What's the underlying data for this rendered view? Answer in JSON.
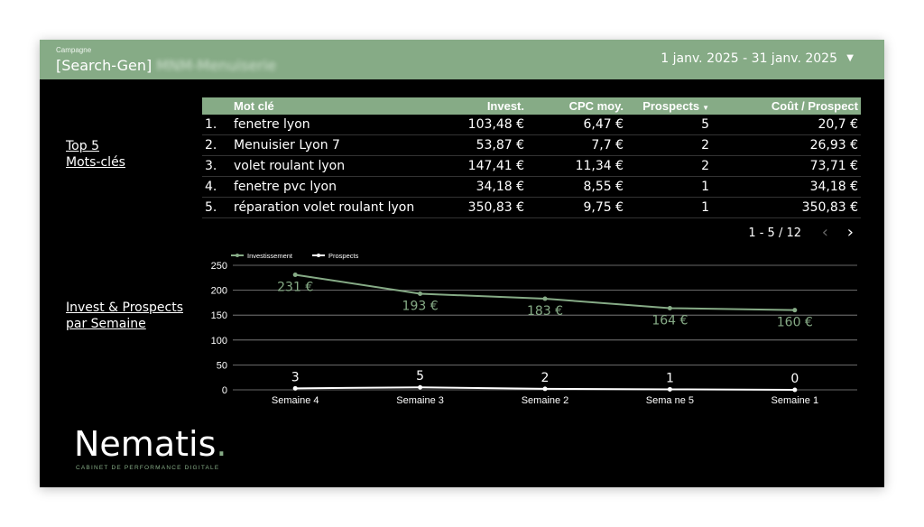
{
  "header": {
    "campaign_label": "Campagne",
    "campaign_name": "[Search-Gen]",
    "campaign_name_blurred": "MNM-Menuiserie",
    "date_range": "1 janv. 2025 - 31 janv. 2025",
    "date_caret": "▼"
  },
  "side": {
    "top_line1": "Top 5",
    "top_line2": "Mots-clés",
    "invest_line1": "Invest & Prospects",
    "invest_line2": "par Semaine"
  },
  "table": {
    "headers": [
      "Mot clé",
      "Invest.",
      "CPC moy.",
      "Prospects",
      "Coût / Prospect"
    ],
    "sort_caret": "▼",
    "rows": [
      [
        "1.",
        "fenetre lyon",
        "103,48 €",
        "6,47 €",
        "5",
        "20,7 €"
      ],
      [
        "2.",
        "Menuisier Lyon 7",
        "53,87 €",
        "7,7 €",
        "2",
        "26,93 €"
      ],
      [
        "3.",
        "volet roulant lyon",
        "147,41 €",
        "11,34 €",
        "2",
        "73,71 €"
      ],
      [
        "4.",
        "fenetre pvc lyon",
        "34,18 €",
        "8,55 €",
        "1",
        "34,18 €"
      ],
      [
        "5.",
        "réparation volet roulant lyon",
        "350,83 €",
        "9,75 €",
        "1",
        "350,83 €"
      ]
    ]
  },
  "pager": {
    "text": "1 - 5 / 12",
    "prev": "‹",
    "next": "›"
  },
  "chart_data": {
    "type": "line",
    "categories": [
      "Semaine 4",
      "Semaine 3",
      "Semaine 2",
      "Sema ne 5",
      "Semaine 1"
    ],
    "series": [
      {
        "name": "Investissement",
        "values": [
          231,
          193,
          183,
          164,
          160
        ],
        "labels": [
          "231 €",
          "193 €",
          "183 €",
          "164 €",
          "160 €"
        ],
        "color": "#86ab86"
      },
      {
        "name": "Prospects",
        "values": [
          3,
          5,
          2,
          1,
          0
        ],
        "labels": [
          "3",
          "5",
          "2",
          "1",
          "0"
        ],
        "color": "#ffffff"
      }
    ],
    "yticks": [
      0,
      50,
      100,
      150,
      200,
      250
    ],
    "ylim": [
      0,
      250
    ],
    "grid": true,
    "legend": "top-left"
  },
  "logo": {
    "text": "Nematis",
    "dot": ".",
    "tagline": "CABINET DE PERFORMANCE DIGITALE"
  },
  "colors": {
    "accent": "#86ab86",
    "background": "#000000"
  }
}
